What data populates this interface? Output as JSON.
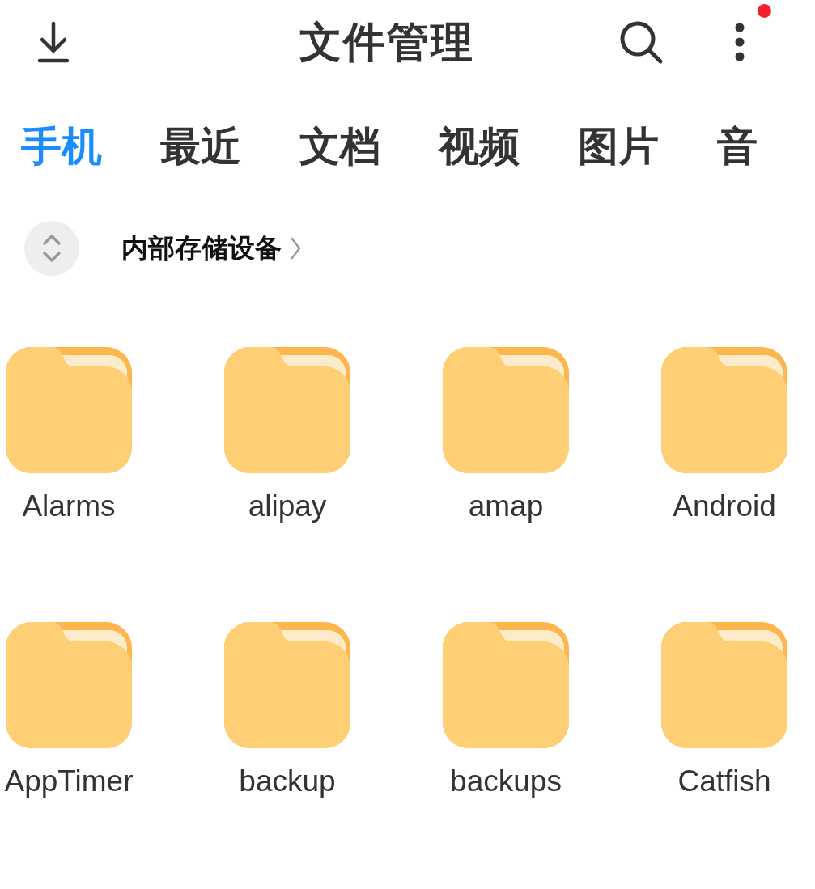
{
  "header": {
    "title": "文件管理",
    "more_badge": true
  },
  "tabs": [
    {
      "label": "手机",
      "selected": true
    },
    {
      "label": "最近",
      "selected": false
    },
    {
      "label": "文档",
      "selected": false
    },
    {
      "label": "视频",
      "selected": false
    },
    {
      "label": "图片",
      "selected": false
    },
    {
      "label": "音",
      "selected": false
    }
  ],
  "storage": {
    "label": "内部存储设备"
  },
  "folders": [
    {
      "name": "Alarms"
    },
    {
      "name": "alipay"
    },
    {
      "name": "amap"
    },
    {
      "name": "Android"
    },
    {
      "name": "AppTimer"
    },
    {
      "name": "backup"
    },
    {
      "name": "backups"
    },
    {
      "name": "Catfish"
    }
  ]
}
